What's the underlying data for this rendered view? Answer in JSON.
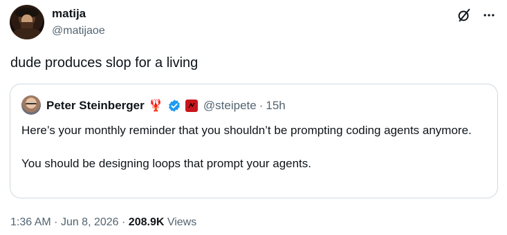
{
  "tweet": {
    "author_name": "matija",
    "author_handle": "@matijaoe",
    "text": "dude produces slop for a living"
  },
  "quote": {
    "author_name": "Peter Steinberger",
    "emoji": "🦞",
    "author_handle": "@steipete",
    "separator": "·",
    "time": "15h",
    "text_line1": "Here’s your monthly reminder that you shouldn’t be prompting coding agents anymore.",
    "text_line2": "You should be designing loops that prompt your agents."
  },
  "meta": {
    "time": "1:36 AM",
    "sep1": "·",
    "date": "Jun 8, 2026",
    "sep2": "·",
    "views_count": "208.9K",
    "views_label": "Views"
  },
  "icons": {
    "grok": "grok-icon",
    "more": "more-icon",
    "verified": "verified-check-icon",
    "verified_color": "#1d9bf0"
  }
}
